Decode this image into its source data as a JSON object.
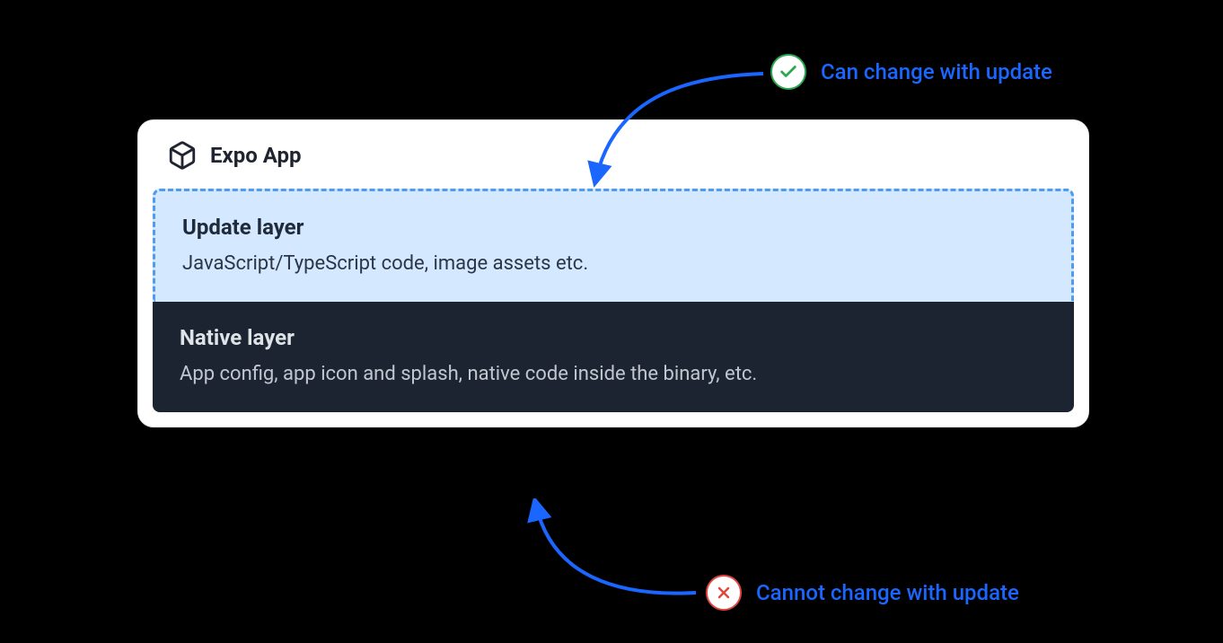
{
  "card": {
    "title": "Expo App",
    "update_layer": {
      "title": "Update layer",
      "description": "JavaScript/TypeScript code, image assets etc."
    },
    "native_layer": {
      "title": "Native layer",
      "description": "App config, app icon and splash, native code inside the binary, etc."
    }
  },
  "annotations": {
    "can_change": "Can change with update",
    "cannot_change": "Cannot change with update"
  },
  "colors": {
    "link_blue": "#1a66ff",
    "dash_blue": "#4e9cf2",
    "update_bg": "#d4e8ff",
    "native_bg": "#1b2430",
    "ok_green": "#2aa84e",
    "no_red": "#e2473e"
  }
}
